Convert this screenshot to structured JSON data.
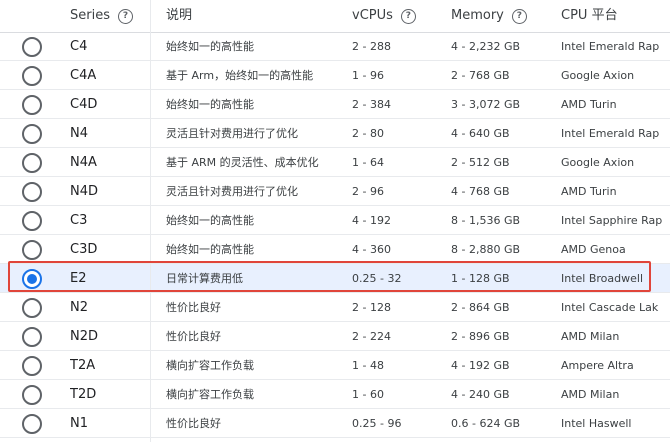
{
  "headers": {
    "series": "Series",
    "description": "说明",
    "vcpus": "vCPUs",
    "memory": "Memory",
    "cpu_platform": "CPU 平台"
  },
  "rows": [
    {
      "series": "C4",
      "desc": "始终如一的高性能",
      "vcpus": "2 - 288",
      "memory": "4 - 2,232 GB",
      "cpu": "Intel Emerald Rap",
      "selected": false
    },
    {
      "series": "C4A",
      "desc": "基于 Arm，始终如一的高性能",
      "vcpus": "1 - 96",
      "memory": "2 - 768 GB",
      "cpu": "Google Axion",
      "selected": false
    },
    {
      "series": "C4D",
      "desc": "始终如一的高性能",
      "vcpus": "2 - 384",
      "memory": "3 - 3,072 GB",
      "cpu": "AMD Turin",
      "selected": false
    },
    {
      "series": "N4",
      "desc": "灵活且针对费用进行了优化",
      "vcpus": "2 - 80",
      "memory": "4 - 640 GB",
      "cpu": "Intel Emerald Rap",
      "selected": false
    },
    {
      "series": "N4A",
      "desc": "基于 ARM 的灵活性、成本优化",
      "vcpus": "1 - 64",
      "memory": "2 - 512 GB",
      "cpu": "Google Axion",
      "selected": false
    },
    {
      "series": "N4D",
      "desc": "灵活且针对费用进行了优化",
      "vcpus": "2 - 96",
      "memory": "4 - 768 GB",
      "cpu": "AMD Turin",
      "selected": false
    },
    {
      "series": "C3",
      "desc": "始终如一的高性能",
      "vcpus": "4 - 192",
      "memory": "8 - 1,536 GB",
      "cpu": "Intel Sapphire Rap",
      "selected": false
    },
    {
      "series": "C3D",
      "desc": "始终如一的高性能",
      "vcpus": "4 - 360",
      "memory": "8 - 2,880 GB",
      "cpu": "AMD Genoa",
      "selected": false
    },
    {
      "series": "E2",
      "desc": "日常计算费用低",
      "vcpus": "0.25 - 32",
      "memory": "1 - 128 GB",
      "cpu": "Intel Broadwell",
      "selected": true
    },
    {
      "series": "N2",
      "desc": "性价比良好",
      "vcpus": "2 - 128",
      "memory": "2 - 864 GB",
      "cpu": "Intel Cascade Lak",
      "selected": false
    },
    {
      "series": "N2D",
      "desc": "性价比良好",
      "vcpus": "2 - 224",
      "memory": "2 - 896 GB",
      "cpu": "AMD Milan",
      "selected": false
    },
    {
      "series": "T2A",
      "desc": "横向扩容工作负载",
      "vcpus": "1 - 48",
      "memory": "4 - 192 GB",
      "cpu": "Ampere Altra",
      "selected": false
    },
    {
      "series": "T2D",
      "desc": "横向扩容工作负载",
      "vcpus": "1 - 60",
      "memory": "4 - 240 GB",
      "cpu": "AMD Milan",
      "selected": false
    },
    {
      "series": "N1",
      "desc": "性价比良好",
      "vcpus": "0.25 - 96",
      "memory": "0.6 - 624 GB",
      "cpu": "Intel Haswell",
      "selected": false
    }
  ],
  "icons": {
    "help": "help-circle-icon",
    "radio": "radio-button-icon"
  },
  "colors": {
    "accent": "#1a73e8",
    "selected_row_bg": "#e8f0fe",
    "highlight_border": "#e0453a"
  }
}
